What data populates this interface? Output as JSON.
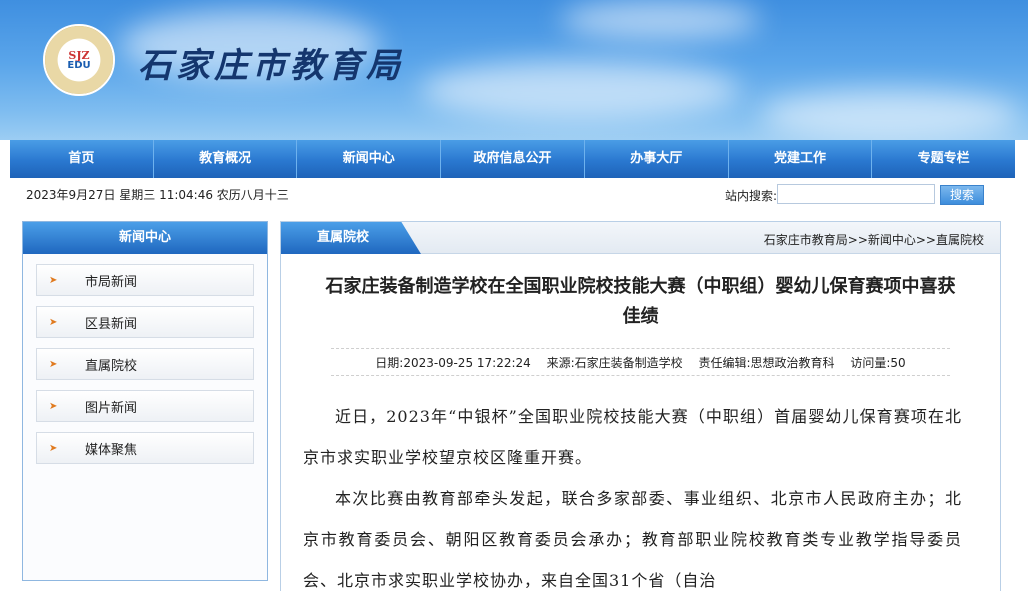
{
  "header": {
    "site_title": "石家庄市教育局",
    "logo_text_1": "SJZ",
    "logo_text_2": "EDU"
  },
  "nav": {
    "items": [
      "首页",
      "教育概况",
      "新闻中心",
      "政府信息公开",
      "办事大厅",
      "党建工作",
      "专题专栏"
    ]
  },
  "infobar": {
    "date": "2023年9月27日 星期三 11:04:46 农历八月十三",
    "search_label": "站内搜索:",
    "search_value": "",
    "search_button": "搜索"
  },
  "sidebar": {
    "title": "新闻中心",
    "items": [
      {
        "label": "市局新闻"
      },
      {
        "label": "区县新闻"
      },
      {
        "label": "直属院校"
      },
      {
        "label": "图片新闻"
      },
      {
        "label": "媒体聚焦"
      }
    ],
    "arrow_glyph": "➤"
  },
  "main": {
    "tab": "直属院校",
    "breadcrumb": "石家庄市教育局>>新闻中心>>直属院校",
    "title": "石家庄装备制造学校在全国职业院校技能大赛（中职组）婴幼儿保育赛项中喜获佳绩",
    "meta": {
      "date": "日期:2023-09-25 17:22:24",
      "source": "来源:石家庄装备制造学校",
      "editor": "责任编辑:思想政治教育科",
      "views": "访问量:50"
    },
    "paragraphs": [
      "近日，2023年“中银杯”全国职业院校技能大赛（中职组）首届婴幼儿保育赛项在北京市求实职业学校望京校区隆重开赛。",
      "本次比赛由教育部牵头发起，联合多家部委、事业组织、北京市人民政府主办；北京市教育委员会、朝阳区教育委员会承办；教育部职业院校教育类专业教学指导委员会、北京市求实职业学校协办，来自全国31个省（自治"
    ]
  },
  "colors": {
    "nav_blue": "#2a78d0",
    "title_navy": "#14366e",
    "arrow_orange": "#e07a1f"
  }
}
